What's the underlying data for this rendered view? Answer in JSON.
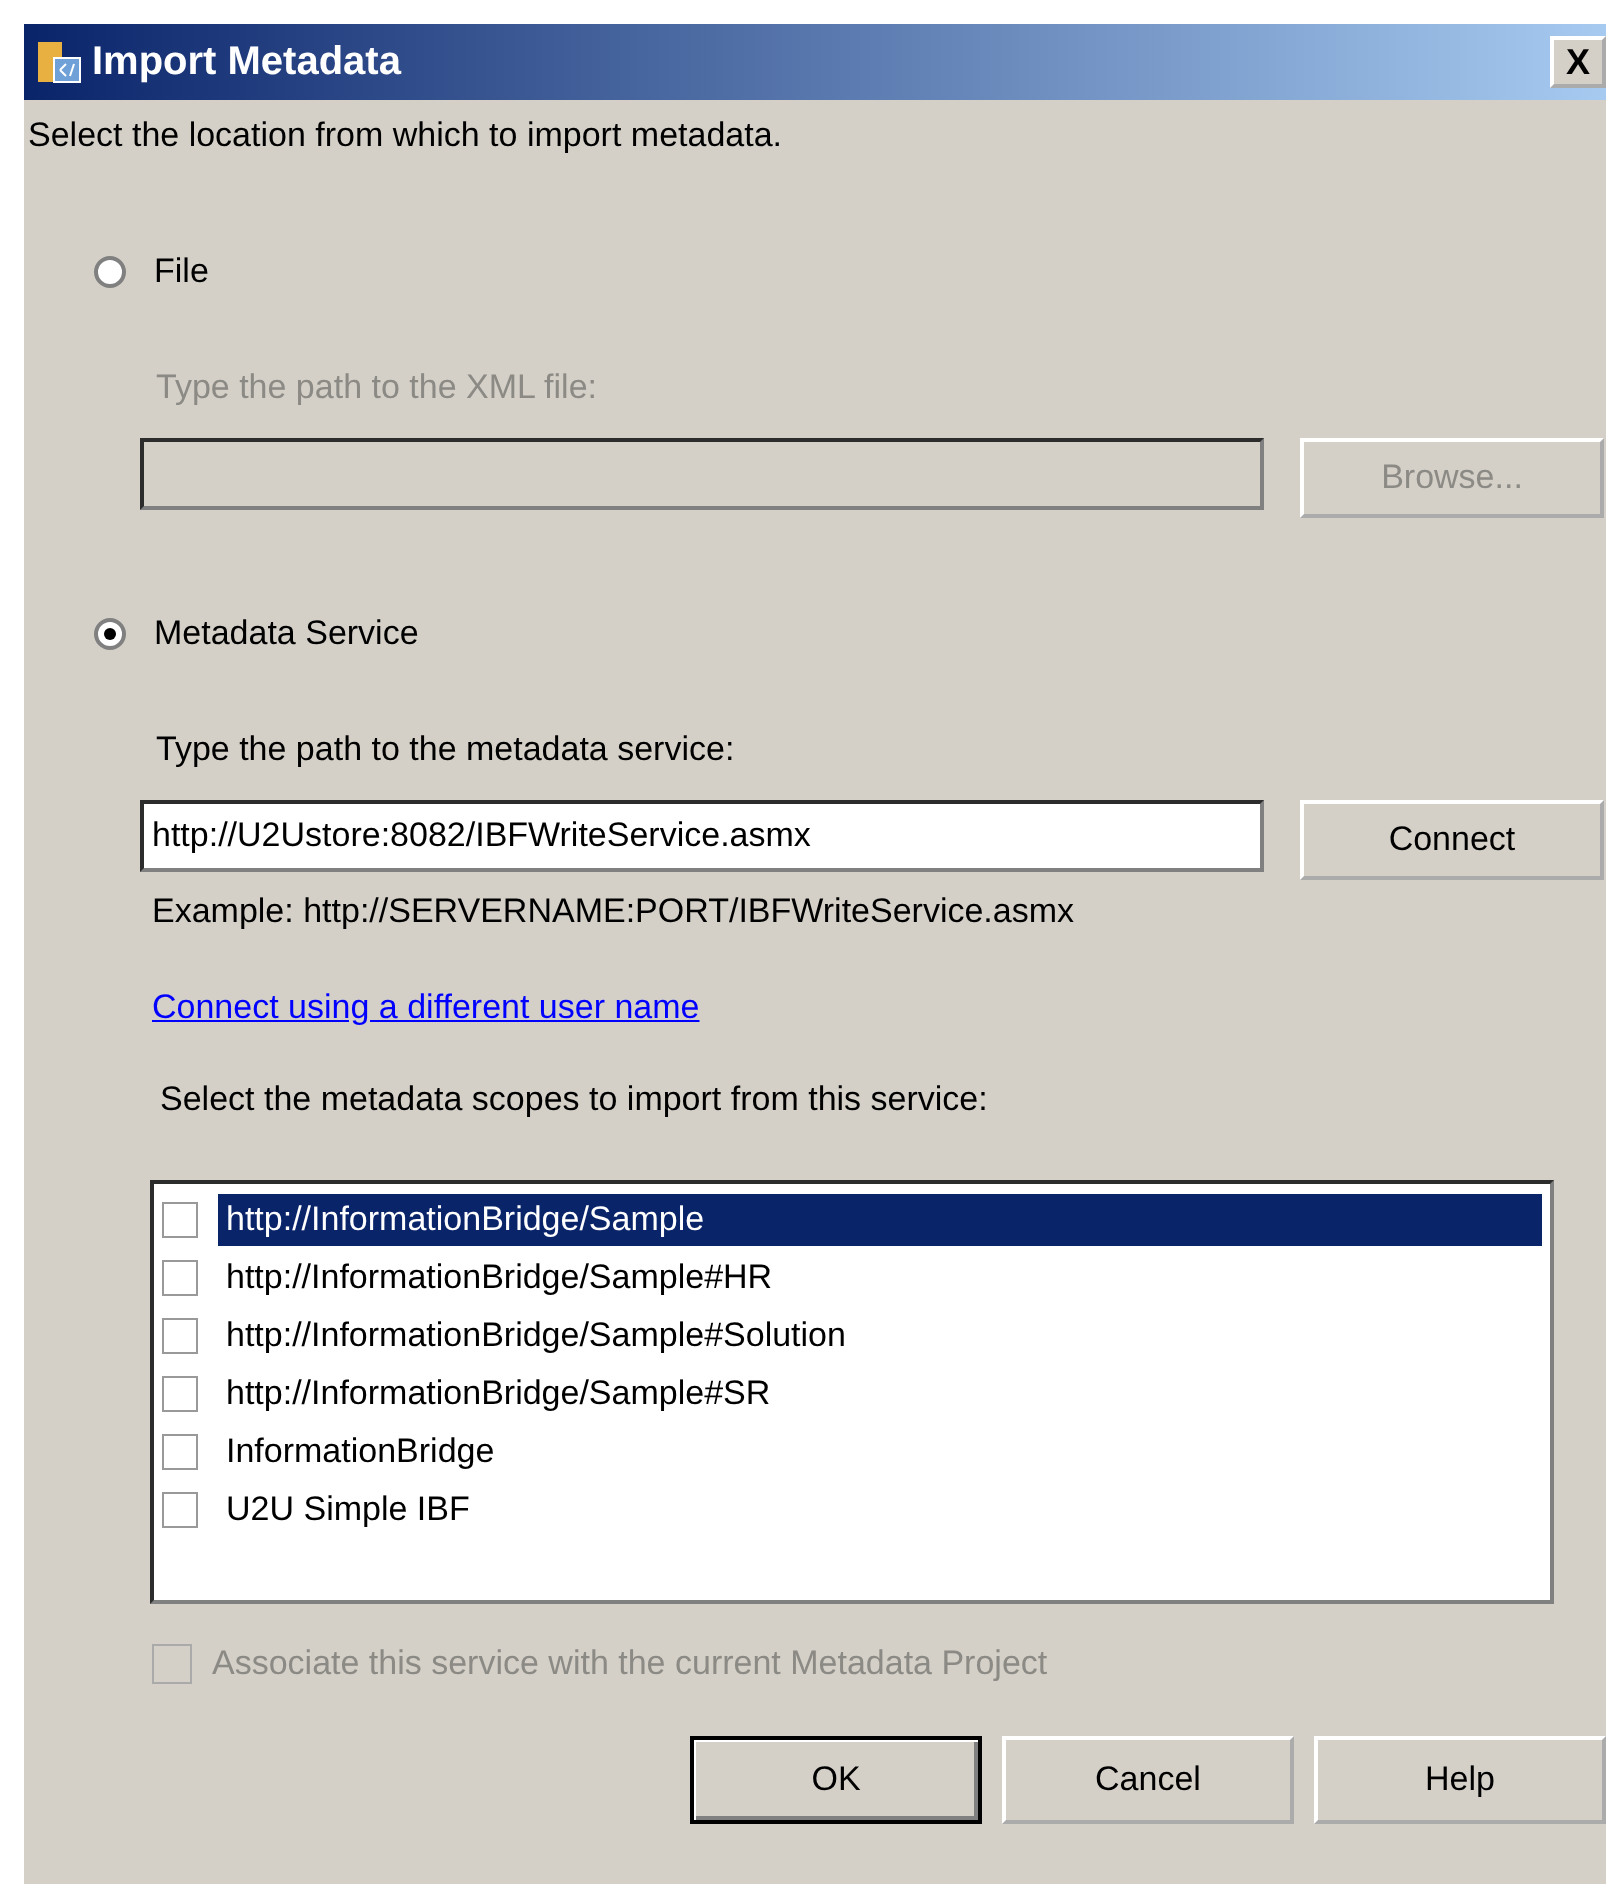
{
  "window": {
    "title": "Import Metadata",
    "close": "X"
  },
  "intro": "Select the location from which to import metadata.",
  "sources": [
    {
      "label": "File",
      "selected": false,
      "hint": "Type the path to the XML file:",
      "button": "Browse...",
      "disabled": true
    },
    {
      "label": "Metadata Service",
      "selected": true,
      "hint": "Type the path to the metadata service:",
      "value": "http://U2Ustore:8082/IBFWriteService.asmx",
      "button": "Connect",
      "disabled": false,
      "example": "Example:  http://SERVERNAME:PORT/IBFWriteService.asmx",
      "link": "Connect using a different user name"
    }
  ],
  "scopes": {
    "label": "Select the metadata scopes to import from this service:",
    "items": [
      {
        "label": "http://InformationBridge/Sample",
        "checked": false,
        "selected": true
      },
      {
        "label": "http://InformationBridge/Sample#HR",
        "checked": false,
        "selected": false
      },
      {
        "label": "http://InformationBridge/Sample#Solution",
        "checked": false,
        "selected": false
      },
      {
        "label": "http://InformationBridge/Sample#SR",
        "checked": false,
        "selected": false
      },
      {
        "label": "InformationBridge",
        "checked": false,
        "selected": false
      },
      {
        "label": "U2U Simple IBF",
        "checked": false,
        "selected": false
      }
    ]
  },
  "associate": {
    "label": "Associate this service with the current Metadata Project",
    "checked": false,
    "disabled": true
  },
  "buttons": [
    {
      "label": "OK",
      "default": true
    },
    {
      "label": "Cancel",
      "default": false
    },
    {
      "label": "Help",
      "default": false
    }
  ]
}
